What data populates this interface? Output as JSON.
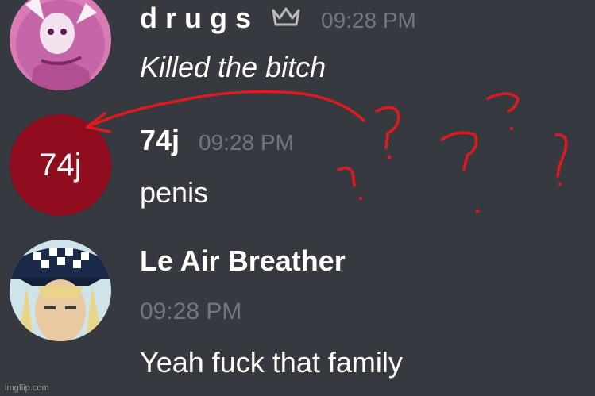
{
  "messages": [
    {
      "username": "d r u g s",
      "timestamp": "09:28 PM",
      "text": "Killed the bitch",
      "owner_icon": "crown-icon"
    },
    {
      "username": "74j",
      "avatar_text": "74j",
      "timestamp": "09:28 PM",
      "text": "penis",
      "avatar_color": "#8f0d1f"
    },
    {
      "username": "Le Air Breather",
      "timestamp": "09:28 PM",
      "text": "Yeah fuck that family"
    }
  ],
  "annotation": {
    "marks": "?  ?  ?  ?  ?",
    "color": "#e0191f"
  },
  "watermark": "imgflip.com",
  "colors": {
    "background": "#36393f",
    "username": "#ffffff",
    "timestamp": "#72767d"
  }
}
